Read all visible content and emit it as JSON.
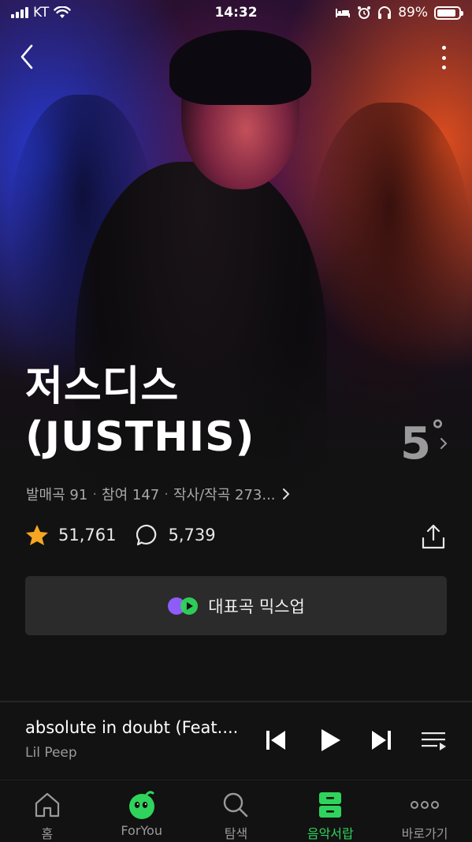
{
  "status_bar": {
    "carrier": "KT",
    "time": "14:32",
    "battery": "89%",
    "battery_level": 0.89
  },
  "artist": {
    "name_line1": "저스디스",
    "name_line2": "(JUSTHIS)",
    "degree_value": "5",
    "degree_mark": "°",
    "meta": {
      "released": "발매곡 91",
      "participated": "참여 147",
      "credits": "작사/작곡 273..."
    },
    "likes": "51,761",
    "comments": "5,739"
  },
  "mix_button": {
    "label": "대표곡 믹스업"
  },
  "player": {
    "track_title": "absolute in doubt (Feat....",
    "track_artist": "Lil Peep"
  },
  "tabs": [
    {
      "label": "홈",
      "icon": "home-icon"
    },
    {
      "label": "ForYou",
      "icon": "foryou-icon"
    },
    {
      "label": "탐색",
      "icon": "search-icon"
    },
    {
      "label": "음악서랍",
      "icon": "drawer-icon",
      "active": true
    },
    {
      "label": "바로가기",
      "icon": "more-horizontal-icon"
    }
  ],
  "colors": {
    "accent_green": "#2fd45c",
    "star_orange": "#f5a623",
    "background": "#121212"
  }
}
